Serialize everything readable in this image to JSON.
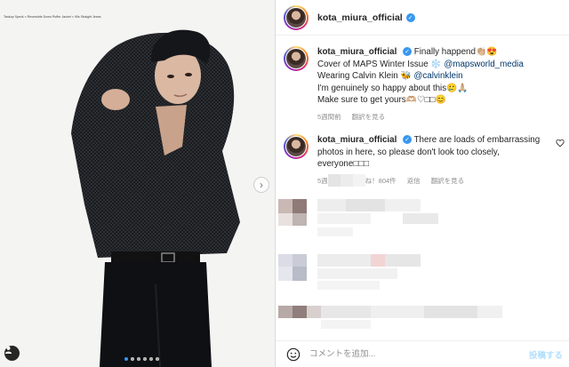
{
  "photo": {
    "caption": "Tankop Speck × Reversible Down Puffer Jacket × 90s Straight Jeans",
    "slide_count": 6,
    "active_slide": 1
  },
  "header": {
    "username": "kota_miura_official",
    "verified": "✓"
  },
  "caption_comment": {
    "username": "kota_miura_official",
    "line1_text": "Finally happend",
    "line1_emoji": "👏🏼😍",
    "line2_text": "Cover of MAPS Winter Issue",
    "line2_emoji": "❄️",
    "line2_mention": "@mapsworld_media",
    "line3_text": "Wearing Calvin Klein",
    "line3_emoji": "🐝",
    "line3_mention": "@calvinklein",
    "line4_text": "I'm genuinely so happy about this",
    "line4_emoji": "🥲🙏🏼",
    "line5_text": "Make sure to get yours",
    "line5_emoji": "🫶🏼♡□□😊",
    "time": "5週間前",
    "translate": "翻訳を見る"
  },
  "reply_comment": {
    "username": "kota_miura_official",
    "text": "There are loads of embarrassing photos in here, so please don't look too closely, everyone□□□",
    "time": "5週間前",
    "likes": "いいね！804件",
    "reply": "返信",
    "translate": "翻訳を見る"
  },
  "add_comment": {
    "placeholder": "コメントを追加...",
    "post": "投稿する"
  },
  "colors": {
    "accent_blue": "#3897f0",
    "mention": "#00376b",
    "muted": "#8e8e8e",
    "post_disabled": "#b2dffc"
  }
}
